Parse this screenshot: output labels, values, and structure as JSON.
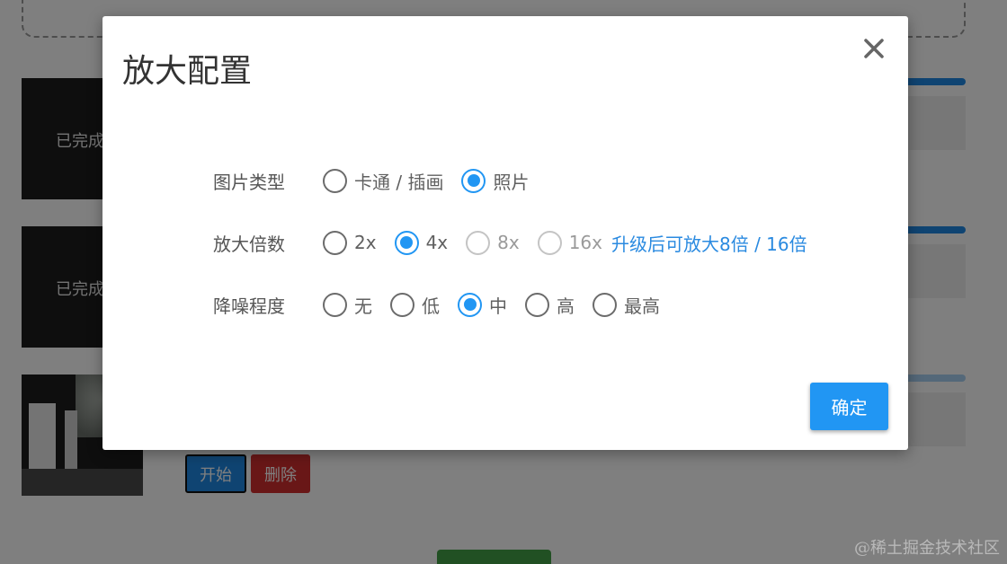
{
  "background": {
    "items": [
      {
        "status": "已完成"
      },
      {
        "status": "已完成"
      }
    ],
    "start_label": "开始",
    "delete_label": "删除"
  },
  "modal": {
    "title": "放大配置",
    "close_icon": "close-icon",
    "image_type": {
      "label": "图片类型",
      "options": [
        "卡通 / 插画",
        "照片"
      ],
      "selected": "照片"
    },
    "scale": {
      "label": "放大倍数",
      "options": [
        "2x",
        "4x",
        "8x",
        "16x"
      ],
      "selected": "4x",
      "disabled": [
        "8x",
        "16x"
      ],
      "upgrade_link": "升级后可放大8倍 / 16倍"
    },
    "denoise": {
      "label": "降噪程度",
      "options": [
        "无",
        "低",
        "中",
        "高",
        "最高"
      ],
      "selected": "中"
    },
    "confirm_label": "确定"
  },
  "watermark": "@稀土掘金技术社区",
  "colors": {
    "accent": "#2196f3",
    "danger": "#d32f2f",
    "success": "#43a047"
  }
}
